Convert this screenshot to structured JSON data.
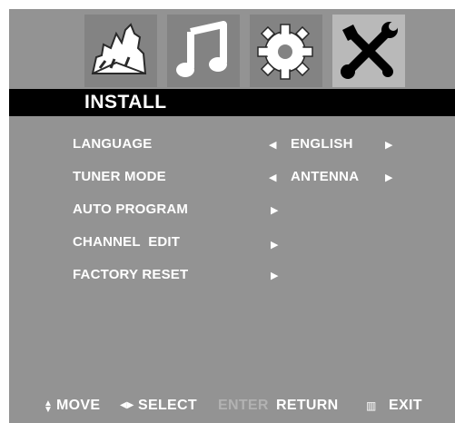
{
  "menu": {
    "title": "INSTALL",
    "tabs": [
      {
        "icon": "picture-icon"
      },
      {
        "icon": "music-note-icon"
      },
      {
        "icon": "gear-icon"
      },
      {
        "icon": "tools-icon"
      }
    ],
    "items": [
      {
        "label": "LANGUAGE",
        "value": "ENGLISH"
      },
      {
        "label": "TUNER MODE",
        "value": "ANTENNA"
      },
      {
        "label": "AUTO PROGRAM"
      },
      {
        "label": "CHANNEL  EDIT"
      },
      {
        "label": "FACTORY RESET"
      }
    ]
  },
  "footer": {
    "move": "MOVE",
    "select": "SELECT",
    "enter": "ENTER",
    "return": "RETURN",
    "exit": "EXIT"
  },
  "colors": {
    "panel": "#939393",
    "tab_active": "#b9b9b9",
    "title_bar": "#000000",
    "text": "#ffffff"
  }
}
